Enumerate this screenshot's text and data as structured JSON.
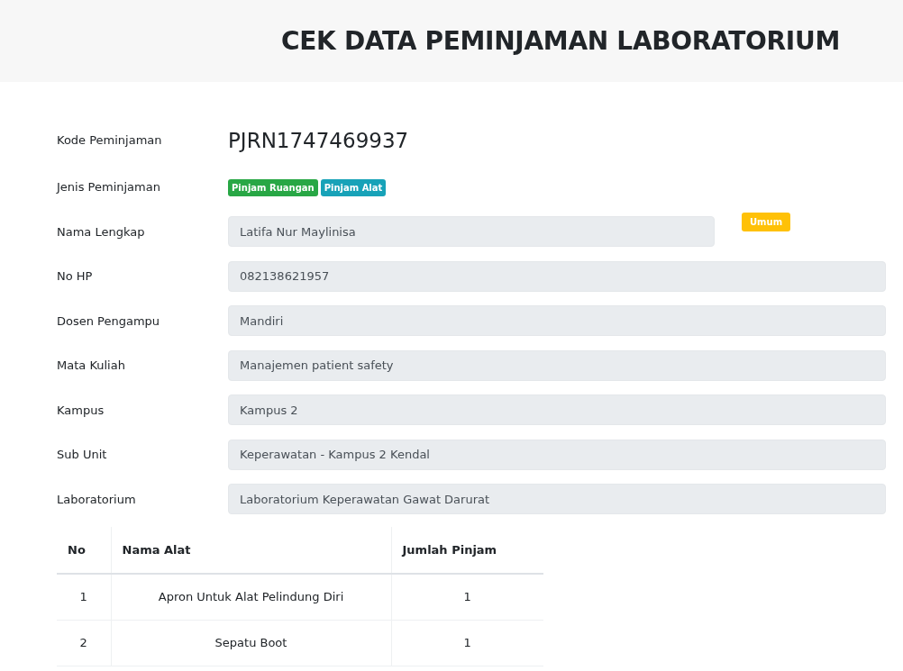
{
  "header": {
    "title": "CEK DATA PEMINJAMAN LABORATORIUM"
  },
  "kode": {
    "label": "Kode Peminjaman",
    "value": "PJRN1747469937"
  },
  "jenis": {
    "label": "Jenis Peminjaman",
    "badges": [
      {
        "text": "Pinjam Ruangan",
        "color": "#28a745"
      },
      {
        "text": "Pinjam Alat",
        "color": "#17a2b8"
      }
    ]
  },
  "fields": [
    {
      "label": "Nama Lengkap",
      "value": "Latifa Nur Maylinisa",
      "tag": {
        "text": "Umum",
        "color": "#ffc107"
      }
    },
    {
      "label": "No HP",
      "value": "082138621957"
    },
    {
      "label": "Dosen Pengampu",
      "value": "Mandiri"
    },
    {
      "label": "Mata Kuliah",
      "value": "Manajemen patient safety"
    },
    {
      "label": "Kampus",
      "value": "Kampus 2"
    },
    {
      "label": "Sub Unit",
      "value": "Keperawatan - Kampus 2 Kendal"
    },
    {
      "label": "Laboratorium",
      "value": "Laboratorium Keperawatan Gawat Darurat"
    }
  ],
  "table": {
    "columns": [
      "No",
      "Nama Alat",
      "Jumlah Pinjam"
    ],
    "rows": [
      [
        "1",
        "Apron Untuk Alat Pelindung Diri",
        "1"
      ],
      [
        "2",
        "Sepatu Boot",
        "1"
      ]
    ]
  }
}
